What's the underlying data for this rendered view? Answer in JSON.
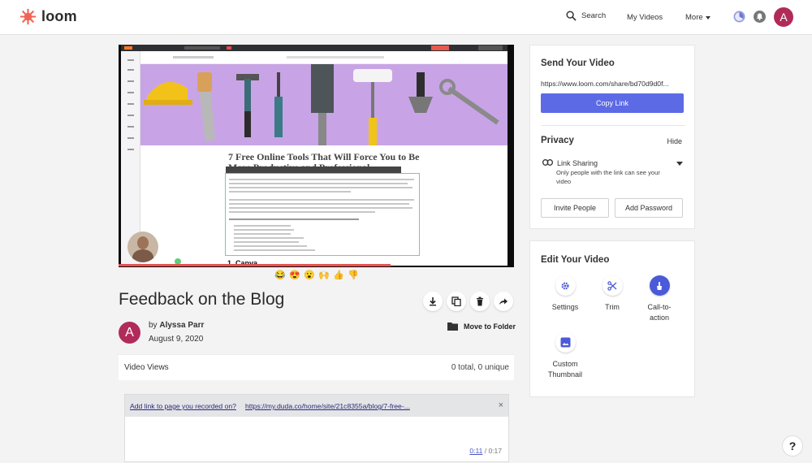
{
  "brand": {
    "name": "loom",
    "color": "#f16454"
  },
  "nav": {
    "search_label": "Search",
    "my_videos_label": "My Videos",
    "more_label": "More",
    "avatar_initial": "A"
  },
  "video_frame": {
    "article_title": "7 Free Online Tools That Will Force You to Be More Productive and Professional",
    "subheading": "1. Canva"
  },
  "reactions": [
    "😂",
    "😍",
    "😮",
    "🙌",
    "👍",
    "👎"
  ],
  "video": {
    "title": "Feedback on the Blog",
    "by_prefix": "by",
    "author": "Alyssa Parr",
    "author_initial": "A",
    "date": "August 9, 2020",
    "move_folder_label": "Move to Folder",
    "views_label": "Video Views",
    "views_count": "0 total, 0 unique"
  },
  "link_prompt": {
    "label": "Add link to page you recorded on?",
    "url": "https://my.duda.co/home/site/21c8355a/blog/7-free-...",
    "close": "×",
    "time_current": "0:11",
    "time_separator": "/",
    "time_total": "0:17"
  },
  "send_panel": {
    "heading": "Send Your Video",
    "share_url": "https://www.loom.com/share/bd70d9d0f...",
    "copy_label": "Copy Link",
    "privacy_heading": "Privacy",
    "hide_label": "Hide",
    "link_sharing_title": "Link Sharing",
    "link_sharing_desc": "Only people with the link can see your video",
    "invite_label": "Invite People",
    "password_label": "Add Password",
    "accent": "#5c6ae6"
  },
  "edit_panel": {
    "heading": "Edit Your Video",
    "settings_label": "Settings",
    "trim_label": "Trim",
    "cta_label": "Call-to-action",
    "thumbnail_label": "Custom Thumbnail"
  },
  "help_label": "?"
}
